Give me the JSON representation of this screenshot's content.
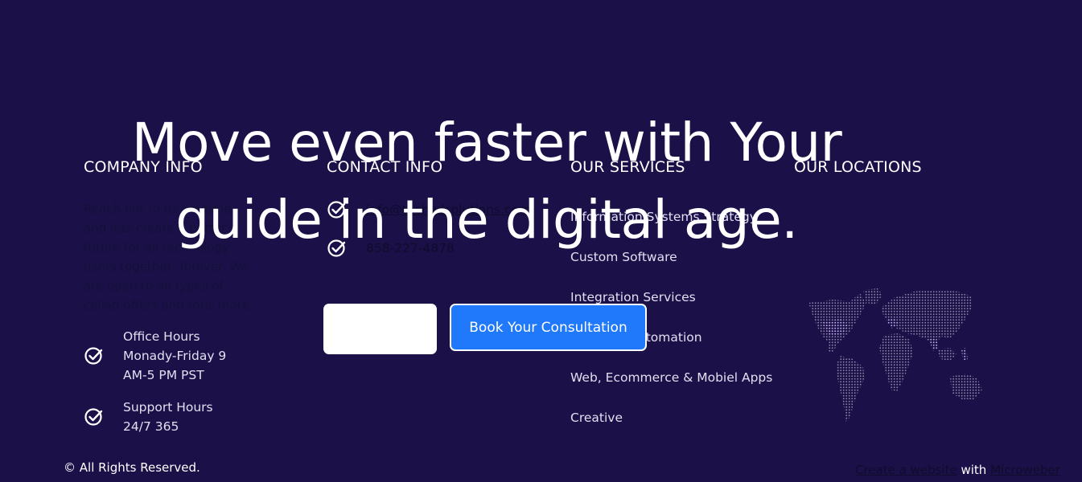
{
  "footer": {
    "company": {
      "title": "COMPANY INFO",
      "about": "Reach out to us anytime and lets create a better future for all technology users together, forever. We are open to all types of collab offers and tons more.",
      "hours": [
        {
          "label": "Office Hours",
          "value": "Monady-Friday 9 AM-5 PM PST"
        },
        {
          "label": "Support Hours",
          "value": "24/7 365"
        }
      ]
    },
    "contact": {
      "title": "CONTACT INFO",
      "email": "info@techvdsolutions.com",
      "phone": "858-227-4878"
    },
    "services": {
      "title": "OUR SERVICES",
      "items": [
        "Information Systems Strategy",
        "Custom Software",
        "Integration Services",
        "Business Automation",
        "Web, Ecommerce & Mobiel Apps",
        "Creative"
      ]
    },
    "locations": {
      "title": "OUR LOCATIONS",
      "map_icon": "world-map"
    },
    "rights": "© All Rights Reserved.",
    "credit": {
      "create_link": "Create a website",
      "with": "with",
      "brand_link": "Microweber"
    }
  },
  "hero": {
    "title_line1": "Move even faster with Your",
    "title_line2": "guide in the digital age.",
    "cta_secondary_label": "",
    "cta_primary_label": "Book Your Consultation"
  },
  "colors": {
    "background": "#1b1048",
    "accent": "#2079fb",
    "text": "#ffffff",
    "muted_text": "#e1dff0",
    "map_dots": "#8c86a4",
    "map_highlight": "#b9a6e6"
  },
  "icons": {
    "check": "check-circle-icon"
  }
}
